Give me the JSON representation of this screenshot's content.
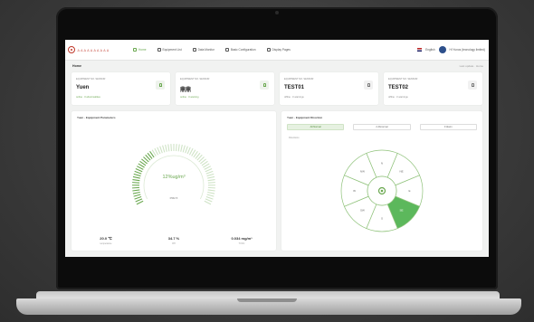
{
  "nav": {
    "brand": "ＡＡＡＡＡＡＡＡＡＡ",
    "menu": [
      {
        "label": "Home",
        "active": true
      },
      {
        "label": "Equipment List",
        "active": false
      },
      {
        "label": "Data Monitor",
        "active": false
      },
      {
        "label": "Basic Configuration",
        "active": false
      },
      {
        "label": "Display Pages",
        "active": false
      }
    ],
    "language": "English",
    "user": "Hi Yunos (tecnology limited)"
  },
  "breadcrumb": "Home",
  "breadcrumb_right": "Last update · Home",
  "cards": [
    {
      "label": "EQUIPMENT NO. SENSOR",
      "name": "Yuen",
      "status": "online · 0 abnormalities",
      "icon": "device-icon"
    },
    {
      "label": "EQUIPMENT NO. SENSOR",
      "name": "鼎鼎",
      "status": "online · 0 warning",
      "icon": "device-icon"
    },
    {
      "label": "EQUIPMENT NO. SENSOR",
      "name": "TEST01",
      "status": "offline · 0 warnings",
      "icon": "device-icon"
    },
    {
      "label": "EQUIPMENT NO. SENSOR",
      "name": "TEST02",
      "status": "offline · 0 warnings",
      "icon": "device-icon"
    }
  ],
  "left_panel": {
    "title": "Yuen - Equipment Parameters",
    "gauge_value": "12%ug/m³",
    "gauge_label": "PM2.5",
    "gauge_fraction": 0.35,
    "stats": [
      {
        "value": "20.0 ℃",
        "label": "temperature"
      },
      {
        "value": "34.7 %",
        "label": "RH"
      },
      {
        "value": "0.034 mg/m³",
        "label": "TVOC"
      }
    ]
  },
  "right_panel": {
    "title": "Yuen - Equipment Direction",
    "tabs": [
      "All Normal",
      "2 Abnormal",
      "0 Alarm"
    ],
    "sub_label": "Directions",
    "sectors": [
      "N",
      "NE",
      "E",
      "SE",
      "S",
      "SW",
      "W",
      "NW"
    ],
    "highlight_sector": "SE"
  },
  "colors": {
    "accent": "#6aa84f",
    "background": "#f1f2f1"
  }
}
